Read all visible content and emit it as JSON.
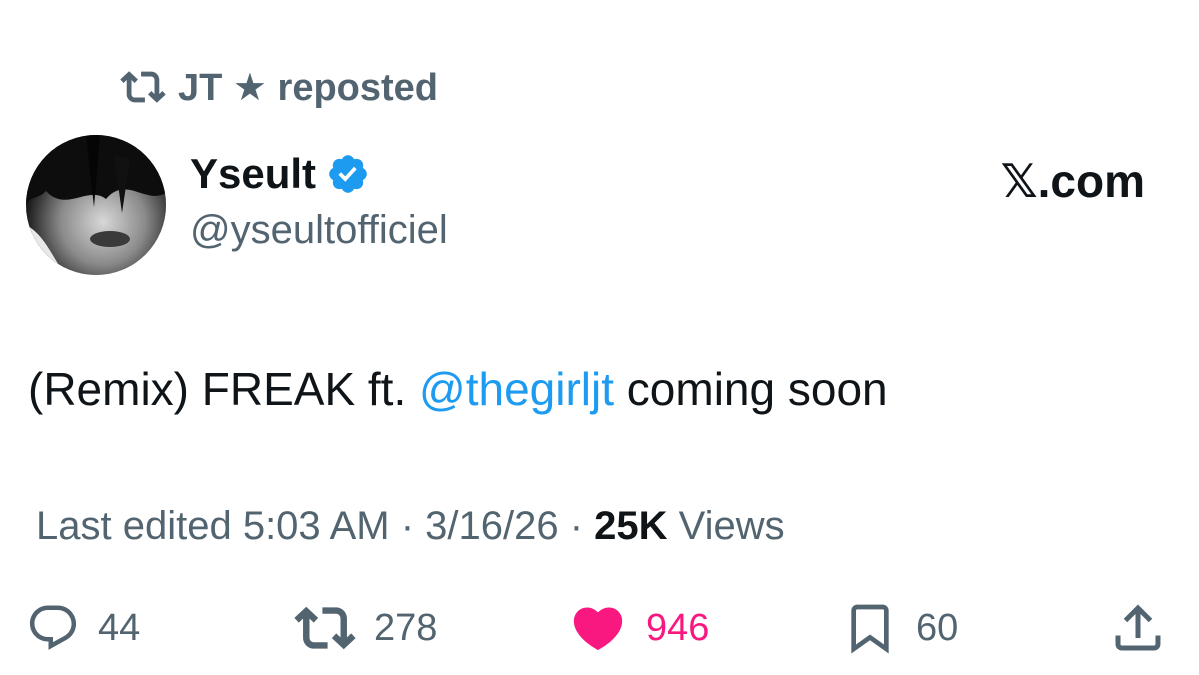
{
  "repost": {
    "text": "JT ★ reposted"
  },
  "author": {
    "name": "Yseult",
    "handle": "@yseultofficiel",
    "verified": true
  },
  "brand": "𝕏.com",
  "tweet": {
    "text_before": "(Remix) FREAK ft. ",
    "mention": "@thegirljt",
    "text_after": " coming soon"
  },
  "meta": {
    "edited": "Last edited 5:03 AM · 3/16/26",
    "separator": " · ",
    "views_count": "25K",
    "views_label": " Views"
  },
  "actions": {
    "replies": "44",
    "reposts": "278",
    "likes": "946",
    "bookmarks": "60"
  },
  "colors": {
    "text": "#0f1419",
    "secondary": "#536471",
    "link": "#1d9bf0",
    "like": "#f91880",
    "verified": "#1d9bf0"
  }
}
